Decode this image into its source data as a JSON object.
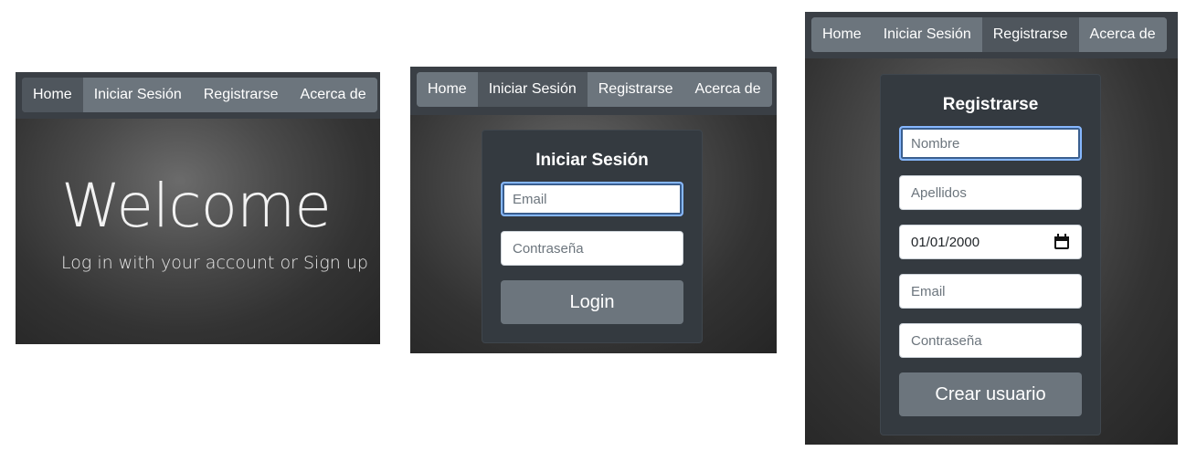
{
  "nav": {
    "items": [
      "Home",
      "Iniciar Sesión",
      "Registrarse",
      "Acerca de"
    ]
  },
  "home": {
    "title": "Welcome",
    "subtitle": "Log in with your account or Sign up"
  },
  "login": {
    "title": "Iniciar Sesión",
    "email_placeholder": "Email",
    "password_placeholder": "Contraseña",
    "submit_label": "Login"
  },
  "register": {
    "title": "Registrarse",
    "name_placeholder": "Nombre",
    "surname_placeholder": "Apellidos",
    "birthdate_value": "01/01/2000",
    "email_placeholder": "Email",
    "password_placeholder": "Contraseña",
    "submit_label": "Crear usuario"
  },
  "icons": {
    "calendar": "calendar-icon"
  },
  "colors": {
    "navbar": "#5f666d",
    "nav_active": "#6c757d",
    "card": "#343a40",
    "button": "#6c757d",
    "focus": "#86b7fe"
  }
}
